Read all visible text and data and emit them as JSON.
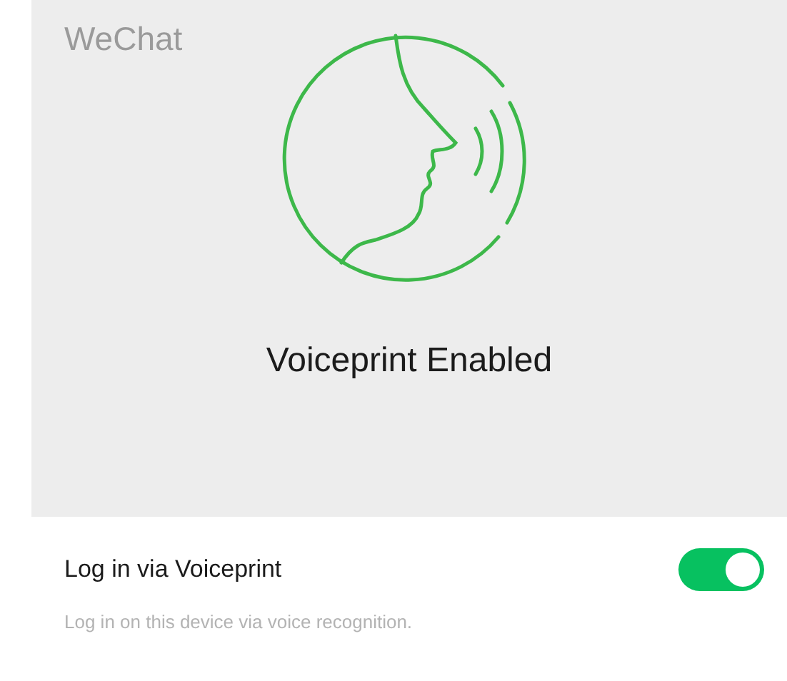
{
  "header": {
    "app_label": "WeChat",
    "status_title": "Voiceprint Enabled"
  },
  "setting": {
    "label": "Log in via Voiceprint",
    "description": "Log in on this device via voice recognition.",
    "on": true
  }
}
